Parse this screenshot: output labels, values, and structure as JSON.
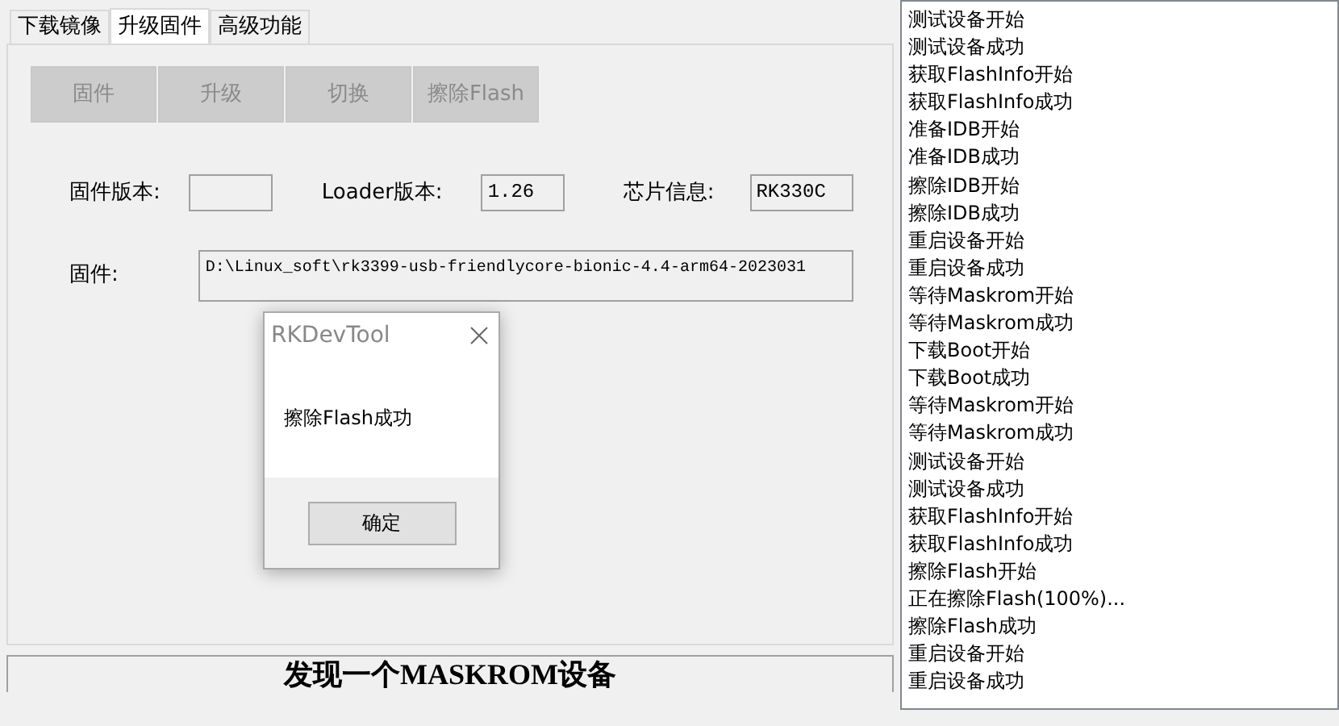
{
  "tabs": [
    {
      "label": "下载镜像",
      "selected": false
    },
    {
      "label": "升级固件",
      "selected": true
    },
    {
      "label": "高级功能",
      "selected": false
    }
  ],
  "toolbar_buttons": [
    {
      "label": "固件",
      "disabled": true
    },
    {
      "label": "升级",
      "disabled": true
    },
    {
      "label": "切换",
      "disabled": true
    },
    {
      "label": "擦除Flash",
      "disabled": true
    }
  ],
  "info_fields": [
    {
      "label": "固件版本:"
    },
    {
      "label": "Loader版本:",
      "value": "1.26"
    },
    {
      "label": "芯片信息:",
      "value": "RK330C"
    }
  ],
  "firmware": {
    "label": "固件:",
    "value": "D:\\Linux_soft\\rk3399-usb-friendlycore-bionic-4.4-arm64-2023031"
  },
  "dialog": {
    "title": "RKDevTool",
    "message": "擦除Flash成功",
    "button": "确定"
  },
  "status_bar": "发现一个MASKROM设备",
  "log": [
    "测试设备开始",
    "测试设备成功",
    "获取FlashInfo开始",
    "获取FlashInfo成功",
    "准备IDB开始",
    "准备IDB成功",
    "擦除IDB开始",
    "擦除IDB成功",
    "重启设备开始",
    "重启设备成功",
    "等待Maskrom开始",
    "等待Maskrom成功",
    "下载Boot开始",
    "下载Boot成功",
    "等待Maskrom开始",
    "等待Maskrom成功",
    "测试设备开始",
    "测试设备成功",
    "获取FlashInfo开始",
    "获取FlashInfo成功",
    "擦除Flash开始",
    "正在擦除Flash(100%)...",
    "擦除Flash成功",
    "重启设备开始",
    "重启设备成功"
  ]
}
